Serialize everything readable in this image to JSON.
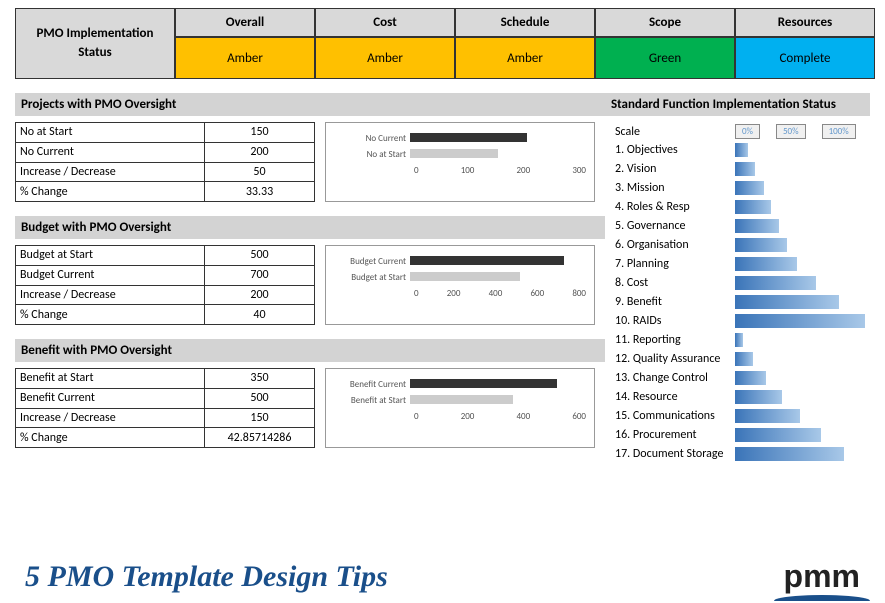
{
  "status": {
    "title": "PMO Implementation Status",
    "headers": [
      "Overall",
      "Cost",
      "Schedule",
      "Scope",
      "Resources"
    ],
    "values": [
      "Amber",
      "Amber",
      "Amber",
      "Green",
      "Complete"
    ],
    "classes": [
      "status-amber",
      "status-amber",
      "status-amber",
      "status-green",
      "status-complete"
    ]
  },
  "sections": {
    "projects": "Projects with PMO Oversight",
    "budget": "Budget with PMO Oversight",
    "benefit": "Benefit with PMO Oversight",
    "functions": "Standard Function Implementation Status"
  },
  "projects": {
    "rows": [
      {
        "label": "No at Start",
        "value": "150"
      },
      {
        "label": "No Current",
        "value": "200"
      },
      {
        "label": "Increase / Decrease",
        "value": "50"
      },
      {
        "label": "% Change",
        "value": "33.33"
      }
    ]
  },
  "budget": {
    "rows": [
      {
        "label": "Budget at Start",
        "value": "500"
      },
      {
        "label": "Budget Current",
        "value": "700"
      },
      {
        "label": "Increase / Decrease",
        "value": "200"
      },
      {
        "label": "% Change",
        "value": "40"
      }
    ]
  },
  "benefit": {
    "rows": [
      {
        "label": "Benefit at Start",
        "value": "350"
      },
      {
        "label": "Benefit Current",
        "value": "500"
      },
      {
        "label": "Increase / Decrease",
        "value": "150"
      },
      {
        "label": "% Change",
        "value": "42.85714286"
      }
    ]
  },
  "scale": {
    "label": "Scale",
    "ticks": [
      "0%",
      "50%",
      "100%"
    ]
  },
  "functions": [
    {
      "label": "1. Objectives",
      "pct": 10
    },
    {
      "label": "2. Vision",
      "pct": 15
    },
    {
      "label": "3. Mission",
      "pct": 22
    },
    {
      "label": "4. Roles & Resp",
      "pct": 28
    },
    {
      "label": "5. Governance",
      "pct": 34
    },
    {
      "label": "6. Organisation",
      "pct": 40
    },
    {
      "label": "7. Planning",
      "pct": 48
    },
    {
      "label": "8. Cost",
      "pct": 62
    },
    {
      "label": "9. Benefit",
      "pct": 80
    },
    {
      "label": "10. RAIDs",
      "pct": 100
    },
    {
      "label": "11. Reporting",
      "pct": 6
    },
    {
      "label": "12. Quality Assurance",
      "pct": 14
    },
    {
      "label": "13. Change Control",
      "pct": 24
    },
    {
      "label": "14. Resource",
      "pct": 36
    },
    {
      "label": "15. Communications",
      "pct": 50
    },
    {
      "label": "16. Procurement",
      "pct": 66
    },
    {
      "label": "17. Document Storage",
      "pct": 84
    }
  ],
  "chart_data": [
    {
      "type": "bar",
      "orientation": "horizontal",
      "categories": [
        "No Current",
        "No at Start"
      ],
      "values": [
        200,
        150
      ],
      "xlim": [
        0,
        300
      ],
      "ticks": [
        0,
        100,
        200,
        300
      ]
    },
    {
      "type": "bar",
      "orientation": "horizontal",
      "categories": [
        "Budget Current",
        "Budget at Start"
      ],
      "values": [
        700,
        500
      ],
      "xlim": [
        0,
        800
      ],
      "ticks": [
        0,
        200,
        400,
        600,
        800
      ]
    },
    {
      "type": "bar",
      "orientation": "horizontal",
      "categories": [
        "Benefit Current",
        "Benefit at Start"
      ],
      "values": [
        500,
        350
      ],
      "xlim": [
        0,
        600
      ],
      "ticks": [
        0,
        200,
        400,
        600
      ]
    }
  ],
  "footer": {
    "title": "5 PMO Template Design Tips",
    "logo": "pmm"
  }
}
